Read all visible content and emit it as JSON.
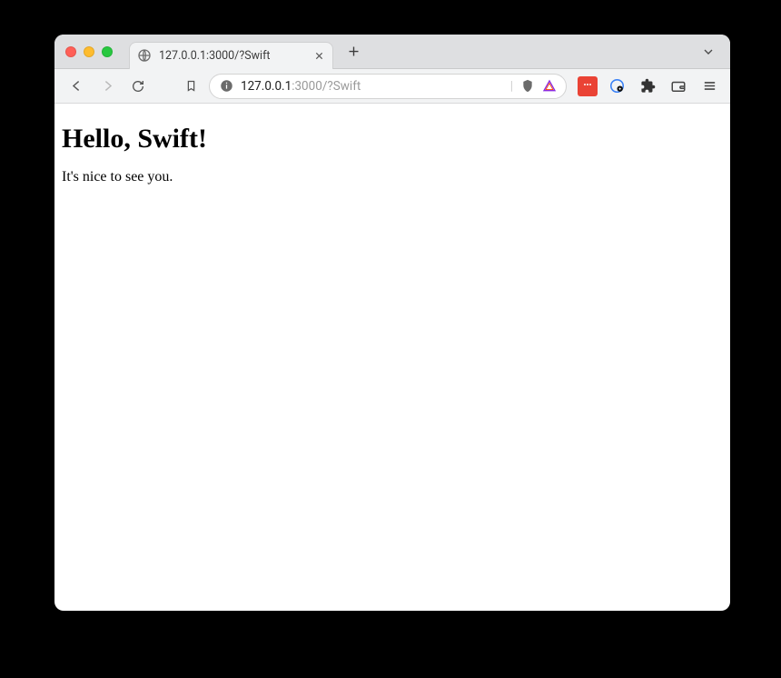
{
  "tab": {
    "title": "127.0.0.1:3000/?Swift"
  },
  "url": {
    "host": "127.0.0.1",
    "port_path": ":3000/?Swift"
  },
  "page": {
    "heading": "Hello, Swift!",
    "paragraph": "It's nice to see you."
  }
}
